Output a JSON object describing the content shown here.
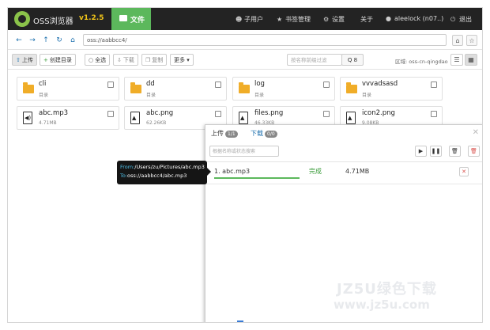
{
  "app": {
    "brand": "OSS浏览器",
    "version": "v1.2.5",
    "file_tab": "文件"
  },
  "nav": {
    "sub_users": "子用户",
    "bookmarks": "书签管理",
    "settings": "设置",
    "about": "关于",
    "account": "aleelock (n07..)",
    "logout": "退出"
  },
  "address": {
    "path": "oss://aabbcc4/"
  },
  "toolbar": {
    "upload": "上传",
    "mkdir": "创建目录",
    "select_all": "全选",
    "download": "下载",
    "copy": "复制",
    "more": "更多",
    "search_placeholder": "按名称前缀过滤",
    "search_btn": "Q",
    "search_count": "8",
    "region": "区域: oss-cn-qingdao"
  },
  "files": [
    {
      "name": "cli",
      "sub": "目录",
      "type": "folder"
    },
    {
      "name": "dd",
      "sub": "目录",
      "type": "folder"
    },
    {
      "name": "log",
      "sub": "目录",
      "type": "folder"
    },
    {
      "name": "vvvadsasd",
      "sub": "目录",
      "type": "folder"
    },
    {
      "name": "abc.mp3",
      "sub": "4.71MB",
      "type": "audio"
    },
    {
      "name": "abc.png",
      "sub": "62.26KB",
      "type": "image"
    },
    {
      "name": "files.png",
      "sub": "46.33KB",
      "type": "image"
    },
    {
      "name": "icon2.png",
      "sub": "9.08KB",
      "type": "image"
    }
  ],
  "transfer": {
    "upload_tab": "上传",
    "upload_count": "1/1",
    "download_tab": "下载",
    "download_count": "0/0",
    "search_placeholder": "根据名称或状态搜索",
    "rows": [
      {
        "name": "1. abc.mp3",
        "status": "完成",
        "size": "4.71MB",
        "progress": 1.0
      }
    ]
  },
  "tooltip": {
    "from_label": "From:",
    "from_path": "/Users/zu/Pictures/abc.mp3",
    "to_label": "To:",
    "to_path": "oss://aabbcc4/abc.mp3"
  },
  "watermark": {
    "line1": "JZ5U绿色下载",
    "line2": "www.jz5u.com"
  },
  "colors": {
    "topbar": "#232323",
    "accent_green": "#5cb85c",
    "link_blue": "#1b6fae",
    "folder": "#f0ad28"
  }
}
